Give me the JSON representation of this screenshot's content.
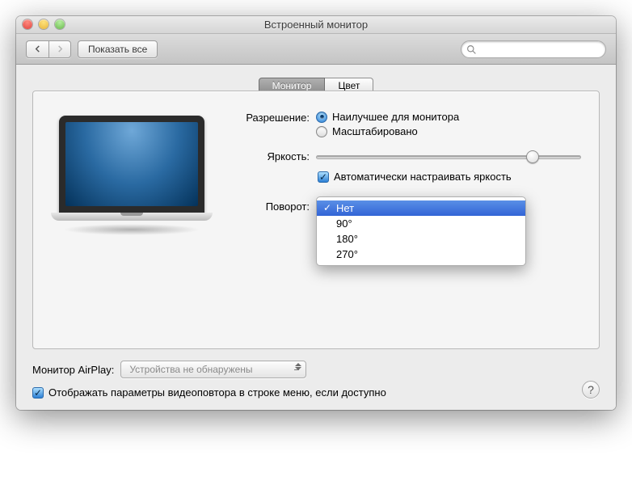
{
  "window": {
    "title": "Встроенный монитор"
  },
  "toolbar": {
    "show_all": "Показать все",
    "search_placeholder": ""
  },
  "tabs": {
    "monitor": "Монитор",
    "color": "Цвет",
    "active": "monitor"
  },
  "settings": {
    "resolution": {
      "label": "Разрешение:",
      "best": "Наилучшее для монитора",
      "scaled": "Масштабировано",
      "selected": "best"
    },
    "brightness": {
      "label": "Яркость:",
      "value_pct": 82,
      "auto_label": "Автоматически настраивать яркость",
      "auto_checked": true
    },
    "rotation": {
      "label": "Поворот:",
      "options": [
        "Нет",
        "90°",
        "180°",
        "270°"
      ],
      "selected_index": 0
    }
  },
  "airplay": {
    "label": "Монитор AirPlay:",
    "value": "Устройства не обнаружены"
  },
  "mirror": {
    "checked": true,
    "label": "Отображать параметры видеоповтора в строке меню, если доступно"
  },
  "help": {
    "symbol": "?"
  }
}
